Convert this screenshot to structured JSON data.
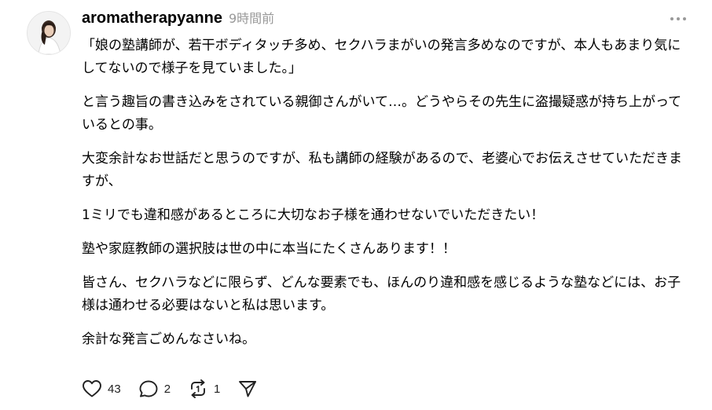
{
  "post": {
    "username": "aromatherapyanne",
    "time": "9時間前",
    "paragraphs": [
      "「娘の塾講師が、若干ボディタッチ多め、セクハラまがいの発言多めなのですが、本人もあまり気にしてないので様子を見ていました。」",
      "と言う趣旨の書き込みをされている親御さんがいて…。どうやらその先生に盗撮疑惑が持ち上がっているとの事。",
      "大変余計なお世話だと思うのですが、私も講師の経験があるので、老婆心でお伝えさせていただきますが、",
      "1ミリでも違和感があるところに大切なお子様を通わせないでいただきたい！",
      "塾や家庭教師の選択肢は世の中に本当にたくさんあります！！",
      "皆さん、セクハラなどに限らず、どんな要素でも、ほんのり違和感を感じるような塾などには、お子様は通わせる必要はないと私は思います。",
      "余計な発言ごめんなさいね。"
    ],
    "actions": {
      "like_count": "43",
      "reply_count": "2",
      "repost_count": "1"
    },
    "icons": {
      "avatar": "avatar",
      "more": "more-icon",
      "like": "heart-icon",
      "reply": "reply-icon",
      "repost": "repost-icon",
      "share": "share-icon"
    },
    "colors": {
      "text": "#000000",
      "meta": "#999999",
      "icon": "#222222"
    }
  }
}
